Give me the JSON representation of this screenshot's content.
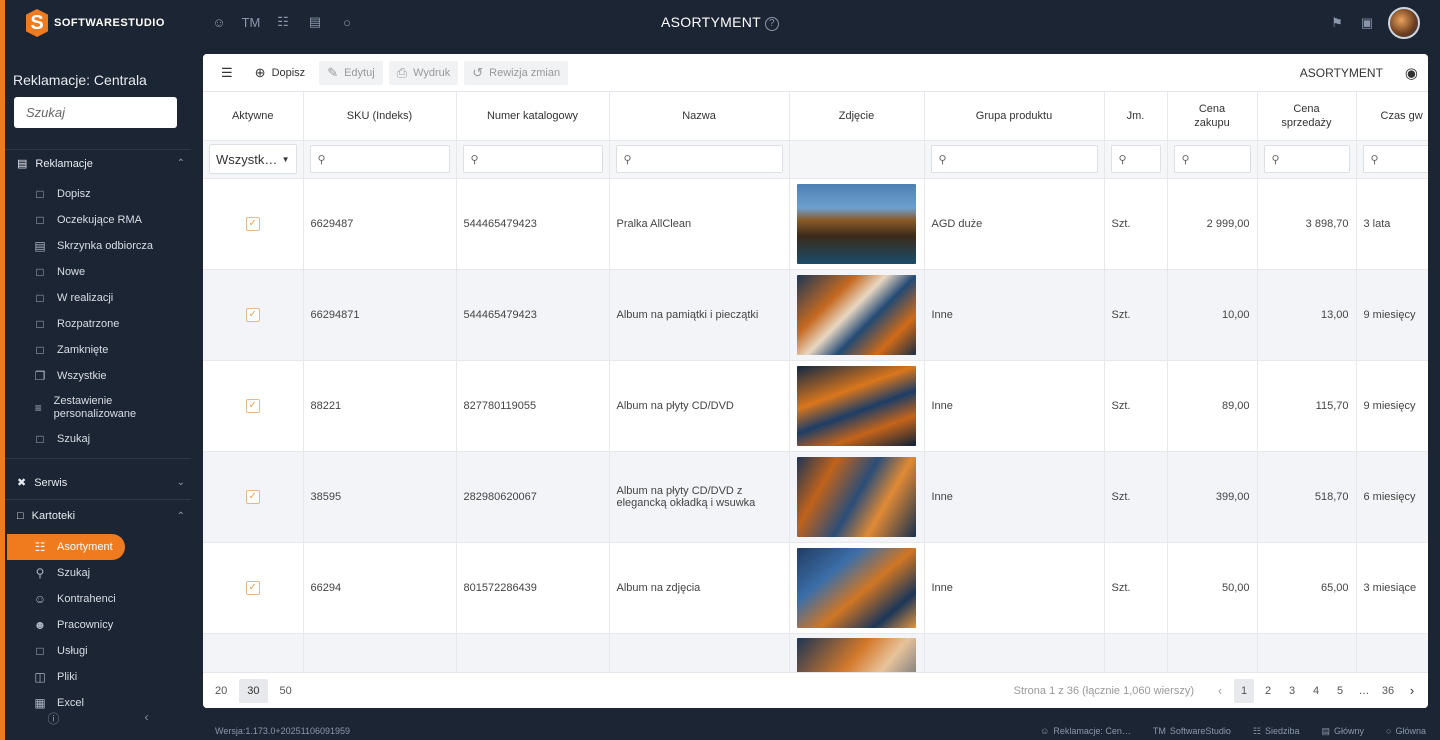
{
  "app": {
    "brand": "SOFTWARESTUDIO",
    "brand_mark": "S",
    "title": "ASORTYMENT",
    "help_glyph": "?",
    "top_icons": [
      "users-icon",
      "tm-icon",
      "hierarchy-icon",
      "warehouse-icon",
      "circle-icon"
    ],
    "tm_label": "TM",
    "accent_color": "#f07a1e"
  },
  "sidebar": {
    "org_title": "Reklamacje: Centrala",
    "search_placeholder": "Szukaj",
    "sections": [
      {
        "label": "Reklamacje",
        "icon": "document-icon"
      },
      {
        "label": "Serwis",
        "icon": "tools-icon"
      },
      {
        "label": "Kartoteki",
        "icon": "folder-icon"
      }
    ],
    "reklamacje_items": [
      {
        "label": "Dopisz",
        "icon": "doc-icon"
      },
      {
        "label": "Oczekujące RMA",
        "icon": "doc-icon"
      },
      {
        "label": "Skrzynka odbiorcza",
        "icon": "inbox-icon"
      },
      {
        "label": "Nowe",
        "icon": "doc-new-icon"
      },
      {
        "label": "W realizacji",
        "icon": "doc-icon"
      },
      {
        "label": "Rozpatrzone",
        "icon": "doc-icon"
      },
      {
        "label": "Zamknięte",
        "icon": "doc-icon"
      },
      {
        "label": "Wszystkie",
        "icon": "copy-icon"
      },
      {
        "label": "Zestawienie personalizowane",
        "icon": "list-icon"
      },
      {
        "label": "Szukaj",
        "icon": "doc-search-icon"
      }
    ],
    "kartoteki_items": [
      {
        "label": "Asortyment",
        "icon": "cart-icon"
      },
      {
        "label": "Szukaj",
        "icon": "search-icon"
      },
      {
        "label": "Kontrahenci",
        "icon": "contacts-icon"
      },
      {
        "label": "Pracownicy",
        "icon": "person-icon"
      },
      {
        "label": "Usługi",
        "icon": "doc-icon"
      },
      {
        "label": "Pliki",
        "icon": "files-icon"
      },
      {
        "label": "Excel",
        "icon": "excel-icon"
      }
    ]
  },
  "toolbar": {
    "add": "Dopisz",
    "edit": "Edytuj",
    "print": "Wydruk",
    "history": "Rewizja zmian",
    "view_title": "ASORTYMENT"
  },
  "grid": {
    "columns": [
      "Aktywne",
      "SKU (Indeks)",
      "Numer katalogowy",
      "Nazwa",
      "Zdjęcie",
      "Grupa produktu",
      "Jm.",
      "Cena zakupu",
      "Cena sprzedaży",
      "Czas gw"
    ],
    "active_filter": "Wszystk…",
    "rows": [
      {
        "active": true,
        "sku": "6629487",
        "catalog": "544465479423",
        "name": "Pralka AllClean",
        "group": "AGD duże",
        "unit": "Szt.",
        "buy": "2 999,00",
        "sell": "3 898,70",
        "warranty": "3 lata"
      },
      {
        "active": true,
        "sku": "66294871",
        "catalog": "544465479423",
        "name": "Album na pamiątki i pieczątki",
        "group": "Inne",
        "unit": "Szt.",
        "buy": "10,00",
        "sell": "13,00",
        "warranty": "9 miesięcy"
      },
      {
        "active": true,
        "sku": "88221",
        "catalog": "827780119055",
        "name": "Album na płyty CD/DVD",
        "group": "Inne",
        "unit": "Szt.",
        "buy": "89,00",
        "sell": "115,70",
        "warranty": "9 miesięcy"
      },
      {
        "active": true,
        "sku": "38595",
        "catalog": "282980620067",
        "name": "Album na płyty CD/DVD z elegancką okładką i wsuwka",
        "group": "Inne",
        "unit": "Szt.",
        "buy": "399,00",
        "sell": "518,70",
        "warranty": "6 miesięcy"
      },
      {
        "active": true,
        "sku": "66294",
        "catalog": "801572286439",
        "name": "Album na zdjęcia",
        "group": "Inne",
        "unit": "Szt.",
        "buy": "50,00",
        "sell": "65,00",
        "warranty": "3 miesiące"
      }
    ]
  },
  "pager": {
    "sizes": [
      "20",
      "30",
      "50"
    ],
    "info": "Strona 1 z 36 (łącznie 1,060 wierszy)",
    "pages": [
      "1",
      "2",
      "3",
      "4",
      "5",
      "…",
      "36"
    ]
  },
  "status": {
    "version": "Wersja:1.173.0+20251106091959",
    "company": "Reklamacje: Cen…",
    "tm": "TM",
    "studio": "SoftwareStudio",
    "seat": "Siedziba",
    "warehouse": "Główny",
    "main": "Główna"
  }
}
